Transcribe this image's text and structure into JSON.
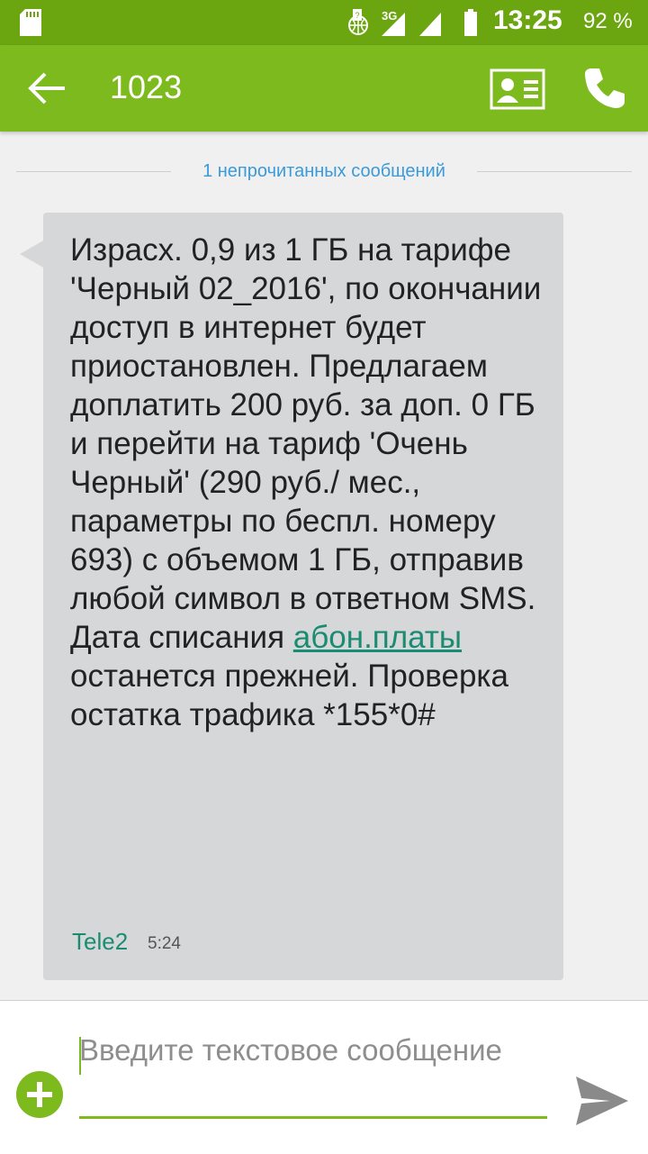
{
  "status_bar": {
    "time": "13:25",
    "battery_percent": "92 %",
    "network_label": "3G",
    "icons": [
      "sd-card-icon",
      "roaming-icon",
      "signal-icon",
      "battery-icon"
    ]
  },
  "app_bar": {
    "title": "1023",
    "icons": [
      "back-arrow-icon",
      "contact-card-icon",
      "phone-icon"
    ],
    "color": "#7dba1e"
  },
  "unread_divider": {
    "text": "1 непрочитанных сообщений"
  },
  "message": {
    "text_before_link": "Израсх. 0,9 из 1 ГБ на тарифе 'Черный 02_2016', по окончании доступ в интернет будет приостановлен. Предлагаем доплатить 200 руб. за доп. 0 ГБ и перейти на тариф 'Очень Черный'  (290 руб./ мес., параметры по беспл. номеру 693) с объемом 1 ГБ, отправив любой символ в ответном SMS. Дата списания ",
    "link_text": "абон.платы",
    "text_after_link": " останется прежней. Проверка остатка трафика *155*0#",
    "sender": "Tele2",
    "time": "5:24"
  },
  "composer": {
    "placeholder": "Введите текстовое сообщение",
    "icons": [
      "add-icon",
      "send-icon"
    ]
  }
}
